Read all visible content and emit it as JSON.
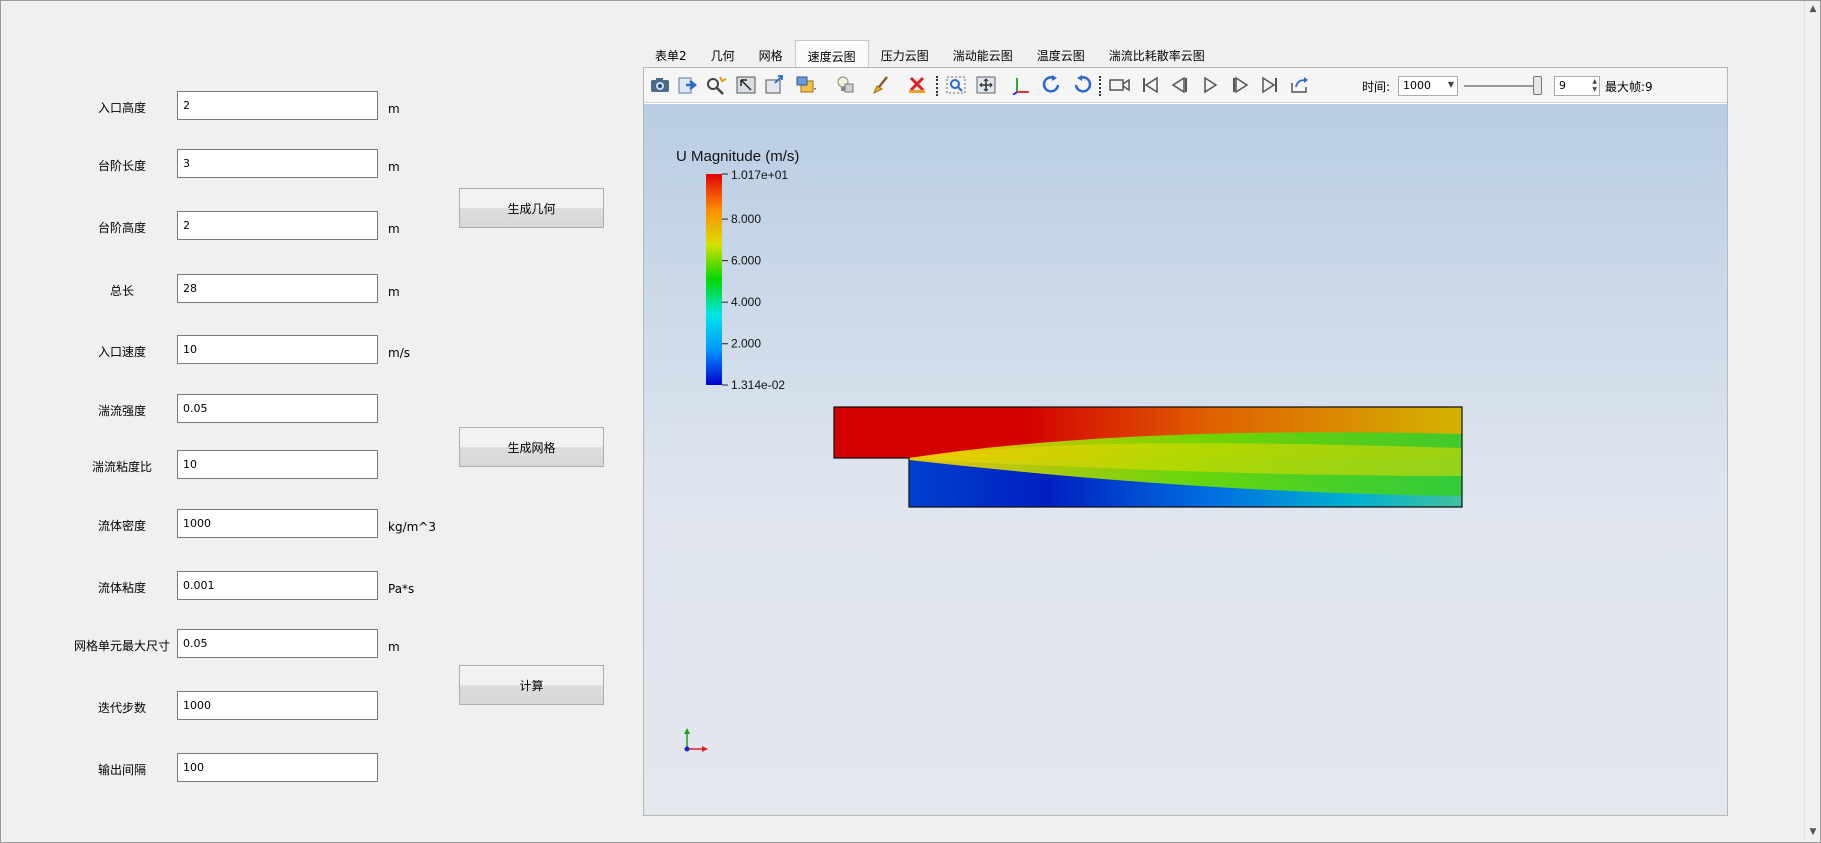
{
  "form": {
    "fields": [
      {
        "label": "入口高度",
        "value": "2",
        "unit": "m"
      },
      {
        "label": "台阶长度",
        "value": "3",
        "unit": "m"
      },
      {
        "label": "台阶高度",
        "value": "2",
        "unit": "m"
      },
      {
        "label": "总长",
        "value": "28",
        "unit": "m"
      },
      {
        "label": "入口速度",
        "value": "10",
        "unit": "m/s"
      },
      {
        "label": "湍流强度",
        "value": "0.05",
        "unit": ""
      },
      {
        "label": "湍流粘度比",
        "value": "10",
        "unit": ""
      },
      {
        "label": "流体密度",
        "value": "1000",
        "unit": "kg/m^3"
      },
      {
        "label": "流体粘度",
        "value": "0.001",
        "unit": "Pa*s"
      },
      {
        "label": "网格单元最大尺寸",
        "value": "0.05",
        "unit": "m"
      },
      {
        "label": "迭代步数",
        "value": "1000",
        "unit": ""
      },
      {
        "label": "输出间隔",
        "value": "100",
        "unit": ""
      }
    ],
    "buttons": {
      "generate_geometry": "生成几何",
      "generate_mesh": "生成网格",
      "compute": "计算"
    }
  },
  "tabs": [
    {
      "label": "表单2",
      "active": false
    },
    {
      "label": "几何",
      "active": false
    },
    {
      "label": "网格",
      "active": false
    },
    {
      "label": "速度云图",
      "active": true
    },
    {
      "label": "压力云图",
      "active": false
    },
    {
      "label": "湍动能云图",
      "active": false
    },
    {
      "label": "温度云图",
      "active": false
    },
    {
      "label": "湍流比耗散率云图",
      "active": false
    }
  ],
  "toolbar": {
    "icons": [
      "camera-icon",
      "export-icon",
      "probe-icon",
      "select-icon",
      "window-icon",
      "layers-icon",
      "lightbulb-icon",
      "brush-icon",
      "delete-icon",
      "zoom-box-icon",
      "fit-icon",
      "axes-icon",
      "rotate-cw-icon",
      "rotate-ccw-icon",
      "video-icon",
      "first-frame-icon",
      "prev-frame-icon",
      "play-icon",
      "next-frame-icon",
      "last-frame-icon",
      "loop-icon"
    ],
    "time_label": "时间:",
    "time_value": "1000",
    "slider_fraction": 1.0,
    "frame_value": "9",
    "max_frame_label": "最大帧:9"
  },
  "colorbar": {
    "title": "U Magnitude (m/s)",
    "max_label": "1.017e+01",
    "min_label": "1.314e-02",
    "ticks": [
      "8.000",
      "6.000",
      "4.000",
      "2.000"
    ],
    "tick_values": [
      8,
      6,
      4,
      2
    ],
    "min": 0.01314,
    "max": 10.17,
    "colors": [
      "#0000d0",
      "#0096ff",
      "#00e8e8",
      "#00d800",
      "#d8e000",
      "#ff8c00",
      "#e00000"
    ]
  },
  "colors": {
    "velocity_high": "#d40000",
    "velocity_mid": "#d8b800",
    "velocity_green": "#22cc22",
    "velocity_low": "#0010c0",
    "axis_x": "#e02020",
    "axis_y": "#20a020",
    "axis_z": "#2020e0"
  }
}
